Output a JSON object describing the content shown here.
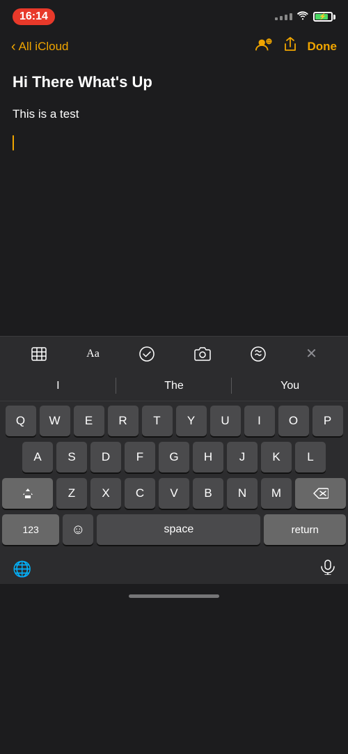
{
  "statusBar": {
    "time": "16:14",
    "batteryPercent": 80
  },
  "navBar": {
    "backLabel": "All iCloud",
    "doneLabel": "Done"
  },
  "note": {
    "title": "Hi There What's Up",
    "body": "This is a test"
  },
  "toolbar": {
    "icons": [
      "table-icon",
      "format-icon",
      "checkmark-icon",
      "camera-icon",
      "markup-icon"
    ],
    "closeLabel": "✕"
  },
  "autocomplete": {
    "suggestions": [
      "I",
      "The",
      "You"
    ]
  },
  "keyboard": {
    "row1": [
      "Q",
      "W",
      "E",
      "R",
      "T",
      "Y",
      "U",
      "I",
      "O",
      "P"
    ],
    "row2": [
      "A",
      "S",
      "D",
      "F",
      "G",
      "H",
      "J",
      "K",
      "L"
    ],
    "row3": [
      "Z",
      "X",
      "C",
      "V",
      "B",
      "N",
      "M"
    ],
    "numbersLabel": "123",
    "spaceLabel": "space",
    "returnLabel": "return"
  },
  "bottomBar": {
    "globeIcon": "globe-icon",
    "micIcon": "microphone-icon"
  }
}
